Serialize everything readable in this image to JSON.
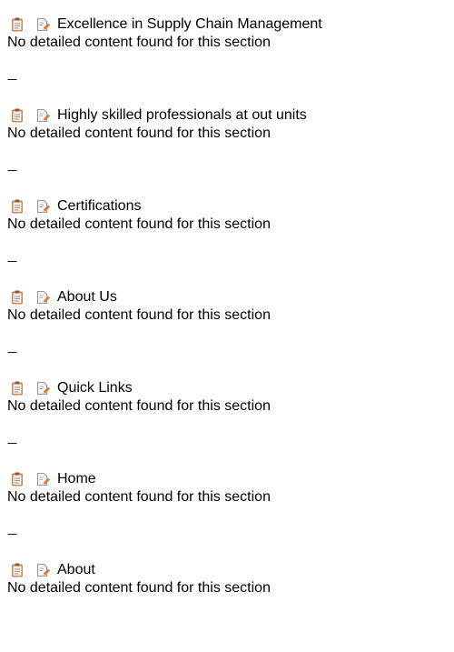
{
  "sections": [
    {
      "title": "Excellence in Supply Chain Management",
      "body": "No detailed content found for this section",
      "divider": "---"
    },
    {
      "title": "Highly skilled professionals at out units",
      "body": "No detailed content found for this section",
      "divider": "---"
    },
    {
      "title": "Certifications",
      "body": "No detailed content found for this section",
      "divider": "---"
    },
    {
      "title": "About Us",
      "body": "No detailed content found for this section",
      "divider": "---"
    },
    {
      "title": "Quick Links",
      "body": "No detailed content found for this section",
      "divider": "---"
    },
    {
      "title": "Home",
      "body": "No detailed content found for this section",
      "divider": "---"
    },
    {
      "title": "About",
      "body": "No detailed content found for this section",
      "divider": ""
    }
  ],
  "icons": {
    "first": "clipboard-icon",
    "second": "edit-document-icon"
  },
  "colors": {
    "clipboard_board": "#c98a5b",
    "clipboard_paper": "#f3ece4",
    "document_paper": "#f6f6f6",
    "pencil": "#e8783a"
  }
}
